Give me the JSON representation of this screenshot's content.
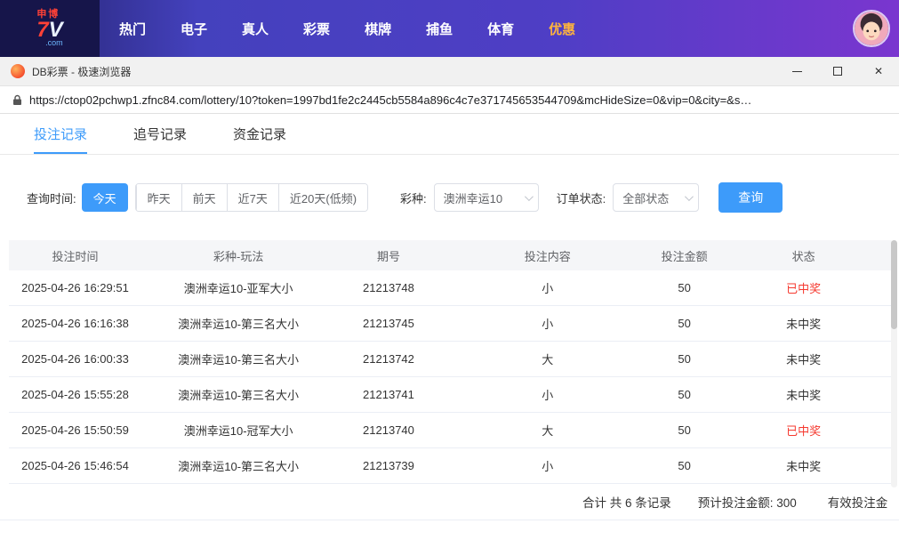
{
  "colors": {
    "accent": "#3d9bfa",
    "win_red": "#f5392f",
    "nav_highlight": "#ffb43c"
  },
  "top_nav": {
    "logo": {
      "brand_small": "申博",
      "big_7": "7",
      "big_v": "V",
      "suffix": ".com"
    },
    "items": [
      {
        "label": "热门",
        "highlight": false
      },
      {
        "label": "电子",
        "highlight": false
      },
      {
        "label": "真人",
        "highlight": false
      },
      {
        "label": "彩票",
        "highlight": false
      },
      {
        "label": "棋牌",
        "highlight": false
      },
      {
        "label": "捕鱼",
        "highlight": false
      },
      {
        "label": "体育",
        "highlight": false
      },
      {
        "label": "优惠",
        "highlight": true
      }
    ]
  },
  "browser": {
    "window_title": "DB彩票 - 极速浏览器",
    "url": "https://ctop02pchwp1.zfnc84.com/lottery/10?token=1997bd1fe2c2445cb5584a896c4c7e371745653544709&mcHideSize=0&vip=0&city=&s…"
  },
  "tabs": [
    {
      "label": "投注记录"
    },
    {
      "label": "追号记录"
    },
    {
      "label": "资金记录"
    }
  ],
  "filters": {
    "time_label": "查询时间:",
    "time_active": "今天",
    "time_group": [
      {
        "label": "昨天"
      },
      {
        "label": "前天"
      },
      {
        "label": "近7天"
      },
      {
        "label": "近20天(低频)"
      }
    ],
    "lottery_label": "彩种:",
    "lottery_value": "澳洲幸运10",
    "status_label": "订单状态:",
    "status_value": "全部状态",
    "search_button": "查询"
  },
  "table": {
    "headers": [
      "投注时间",
      "彩种-玩法",
      "期号",
      "投注内容",
      "投注金额",
      "状态"
    ],
    "rows": [
      {
        "time": "2025-04-26 16:29:51",
        "game": "澳洲幸运10-亚军大小",
        "issue": "21213748",
        "content": "小",
        "amount": "50",
        "status": "已中奖",
        "won": true
      },
      {
        "time": "2025-04-26 16:16:38",
        "game": "澳洲幸运10-第三名大小",
        "issue": "21213745",
        "content": "小",
        "amount": "50",
        "status": "未中奖",
        "won": false
      },
      {
        "time": "2025-04-26 16:00:33",
        "game": "澳洲幸运10-第三名大小",
        "issue": "21213742",
        "content": "大",
        "amount": "50",
        "status": "未中奖",
        "won": false
      },
      {
        "time": "2025-04-26 15:55:28",
        "game": "澳洲幸运10-第三名大小",
        "issue": "21213741",
        "content": "小",
        "amount": "50",
        "status": "未中奖",
        "won": false
      },
      {
        "time": "2025-04-26 15:50:59",
        "game": "澳洲幸运10-冠军大小",
        "issue": "21213740",
        "content": "大",
        "amount": "50",
        "status": "已中奖",
        "won": true
      },
      {
        "time": "2025-04-26 15:46:54",
        "game": "澳洲幸运10-第三名大小",
        "issue": "21213739",
        "content": "小",
        "amount": "50",
        "status": "未中奖",
        "won": false
      }
    ]
  },
  "summary": {
    "total_text": "合计 共 6 条记录",
    "expected_text": "预计投注金额: 300",
    "valid_text": "有效投注金"
  }
}
